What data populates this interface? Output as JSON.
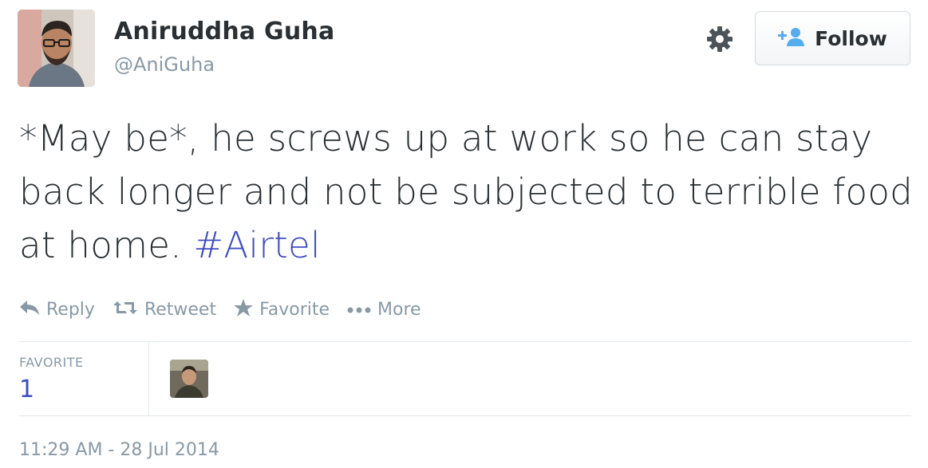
{
  "author": {
    "fullname": "Aniruddha Guha",
    "username": "@AniGuha",
    "avatar_icon": "user-avatar"
  },
  "header": {
    "gear_icon": "gear-icon",
    "follow_label": "Follow",
    "follow_icon": "add-person-icon"
  },
  "tweet": {
    "text": "*May be*, he screws up at work so he can stay back longer and not be subjected to terrible food at home.",
    "hashtag": "#Airtel"
  },
  "actions": {
    "reply": "Reply",
    "retweet": "Retweet",
    "favorite": "Favorite",
    "more": "More"
  },
  "stats": {
    "favorite_label": "FAVORITE",
    "favorite_count": "1"
  },
  "timestamp": "11:29 AM - 28 Jul 2014",
  "colors": {
    "text": "#292f33",
    "muted": "#8899a6",
    "link": "#3b4dc1",
    "border": "#e1e8ed"
  }
}
